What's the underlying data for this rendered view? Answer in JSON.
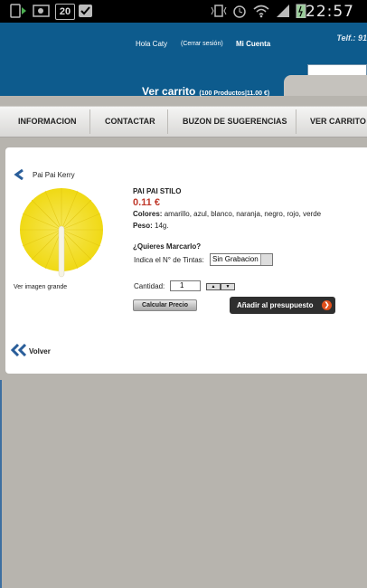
{
  "status_bar": {
    "notification_count": "20",
    "time": "22:57"
  },
  "header": {
    "greeting": "Hola Caty",
    "logout": "(Cerrar sesión)",
    "account": "Mi Cuenta",
    "phone": "Telf.: 91",
    "cart_label": "Ver carrito",
    "cart_summary": "(100 Productos|11.00 €)"
  },
  "nav": {
    "items": [
      "INFORMACION",
      "CONTACTAR",
      "BUZON DE SUGERENCIAS",
      "VER CARRITO"
    ]
  },
  "product": {
    "breadcrumb": "Pai Pai Kerry",
    "view_large": "Ver imagen grande",
    "name": "PAI PAI STILO",
    "price": "0.11 €",
    "colors_label": "Colores:",
    "colors_value": "amarillo, azul, blanco, naranja, negro, rojo, verde",
    "weight_label": "Peso:",
    "weight_value": "14g.",
    "mark_question": "¿Quieres Marcarlo?",
    "inks_label": "Indica el N° de Tintas:",
    "inks_selected": "Sin Grabacion",
    "qty_label": "Cantidad:",
    "qty_value": "1",
    "calc_button": "Calcular Precio",
    "add_button": "Añadir al presupuesto",
    "back": "Volver"
  },
  "colors": {
    "header_blue": "#0d5b8d",
    "price_red": "#c0392b",
    "fan_yellow": "#f4e12a"
  }
}
